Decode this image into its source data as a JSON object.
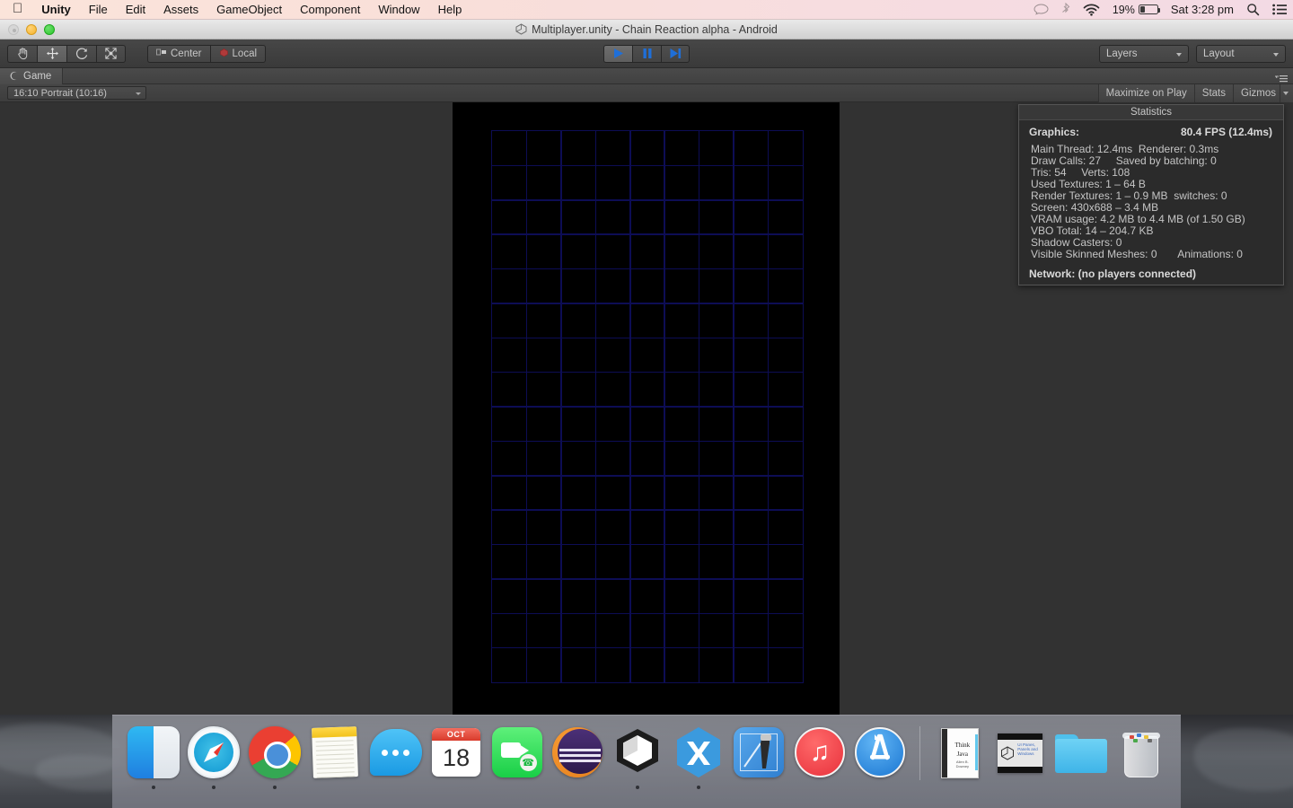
{
  "menubar": {
    "apple_icon": "apple-icon",
    "app_name": "Unity",
    "items": [
      "File",
      "Edit",
      "Assets",
      "GameObject",
      "Component",
      "Window",
      "Help"
    ],
    "status": {
      "notification_icon": "speech-bubble-icon",
      "bluetooth_icon": "bluetooth-icon",
      "wifi_icon": "wifi-icon",
      "battery_percent": "19%",
      "battery_icon": "battery-icon",
      "clock": "Sat 3:28 pm",
      "search_icon": "search-icon",
      "notification_center_icon": "list-icon"
    }
  },
  "window": {
    "title": "Multiplayer.unity - Chain Reaction alpha - Android",
    "title_icon": "unity-logo-icon",
    "traffic_lights": [
      "close",
      "minimize",
      "maximize"
    ]
  },
  "toolbar": {
    "transform_tools": [
      {
        "name": "hand-tool",
        "active": false
      },
      {
        "name": "move-tool",
        "active": true
      },
      {
        "name": "rotate-tool",
        "active": false
      },
      {
        "name": "scale-tool",
        "active": false
      }
    ],
    "pivot_label": "Center",
    "pivot_icon": "pivot-center-icon",
    "rotation_label": "Local",
    "rotation_icon": "rotation-local-icon",
    "play_controls": [
      {
        "name": "play-button",
        "icon": "play-icon",
        "active": true
      },
      {
        "name": "pause-button",
        "icon": "pause-icon",
        "active": false
      },
      {
        "name": "step-button",
        "icon": "step-icon",
        "active": false
      }
    ],
    "layers_label": "Layers",
    "layout_label": "Layout"
  },
  "game_view": {
    "tab_label": "Game",
    "tab_icon": "game-view-icon",
    "aspect_ratio": "16:10 Portrait (10:16)",
    "maximize_on_play": "Maximize on Play",
    "stats_button": "Stats",
    "gizmos_button": "Gizmos",
    "panel_menu_icon": "panel-menu-icon",
    "grid": {
      "columns": 9,
      "rows": 16,
      "line_color": "#0d0d55",
      "background_color": "#000000"
    }
  },
  "statistics": {
    "header": "Statistics",
    "graphics_label": "Graphics:",
    "fps": "80.4 FPS (12.4ms)",
    "lines": [
      "Main Thread: 12.4ms  Renderer: 0.3ms",
      "Draw Calls: 27     Saved by batching: 0",
      "Tris: 54     Verts: 108",
      "Used Textures: 1 – 64 B",
      "Render Textures: 1 – 0.9 MB  switches: 0",
      "Screen: 430x688 – 3.4 MB",
      "VRAM usage: 4.2 MB to 4.4 MB (of 1.50 GB)",
      "VBO Total: 14 – 204.7 KB",
      "Shadow Casters: 0",
      "Visible Skinned Meshes: 0       Animations: 0"
    ],
    "network": "Network: (no players connected)"
  },
  "dock": {
    "items": [
      {
        "name": "finder",
        "icon": "finder-icon",
        "running": true
      },
      {
        "name": "safari",
        "icon": "safari-icon",
        "running": true
      },
      {
        "name": "chrome",
        "icon": "chrome-icon",
        "running": true
      },
      {
        "name": "notes",
        "icon": "notes-icon",
        "running": false
      },
      {
        "name": "messages",
        "icon": "messages-icon",
        "running": false
      },
      {
        "name": "calendar",
        "icon": "calendar-icon",
        "running": false,
        "month": "OCT",
        "day": "18"
      },
      {
        "name": "facetime",
        "icon": "facetime-icon",
        "running": false
      },
      {
        "name": "eclipse",
        "icon": "eclipse-icon",
        "running": false
      },
      {
        "name": "unity",
        "icon": "unity-icon",
        "running": true
      },
      {
        "name": "xamarin-studio",
        "icon": "xamarin-icon",
        "running": true
      },
      {
        "name": "xcode",
        "icon": "xcode-icon",
        "running": false
      },
      {
        "name": "itunes",
        "icon": "itunes-icon",
        "running": false
      },
      {
        "name": "app-store",
        "icon": "app-store-icon",
        "running": false
      }
    ],
    "stack_items": [
      {
        "name": "think-java-pdf",
        "icon": "pdf-document-icon",
        "title_line1": "Think",
        "title_line2": "Java",
        "title_line3": "Allen B. Downey"
      },
      {
        "name": "unity-tutorial-video",
        "icon": "video-file-icon",
        "caption": "UI Panes, Panels and Windows"
      },
      {
        "name": "downloads-folder",
        "icon": "folder-icon"
      },
      {
        "name": "trash",
        "icon": "trash-icon"
      }
    ]
  }
}
